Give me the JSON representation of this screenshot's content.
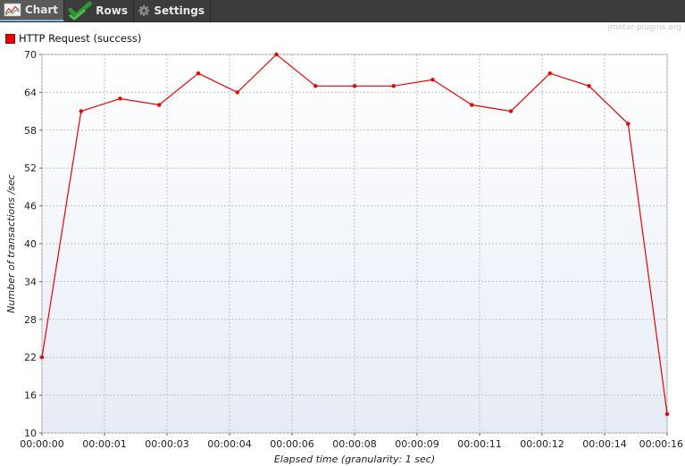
{
  "tabs": [
    {
      "label": "Chart",
      "icon": "chart-icon",
      "active": true
    },
    {
      "label": "Rows",
      "icon": "checkmark-icon",
      "active": false
    },
    {
      "label": "Settings",
      "icon": "gear-icon",
      "active": false
    }
  ],
  "plugin_tag": "jmeter-plugins.org",
  "colors": {
    "series": "#ee0000",
    "grid": "#c0c0c0",
    "toolbar": "#3c3c3c"
  },
  "chart_data": {
    "type": "line",
    "xlabel": "Elapsed time (granularity: 1 sec)",
    "ylabel": "Number of transactions /sec",
    "ylim": [
      10,
      70
    ],
    "yticks": [
      10,
      16,
      22,
      28,
      34,
      40,
      46,
      52,
      58,
      64,
      70
    ],
    "xlim": [
      0,
      16
    ],
    "xticks": [
      {
        "x": 0,
        "label": "00:00:00"
      },
      {
        "x": 1.6,
        "label": "00:00:01"
      },
      {
        "x": 3.2,
        "label": "00:00:03"
      },
      {
        "x": 4.8,
        "label": "00:00:04"
      },
      {
        "x": 6.4,
        "label": "00:00:06"
      },
      {
        "x": 8,
        "label": "00:00:08"
      },
      {
        "x": 9.6,
        "label": "00:00:09"
      },
      {
        "x": 11.2,
        "label": "00:00:11"
      },
      {
        "x": 12.8,
        "label": "00:00:12"
      },
      {
        "x": 14.4,
        "label": "00:00:14"
      },
      {
        "x": 16,
        "label": "00:00:16"
      }
    ],
    "grid": true,
    "legend_position": "top-left",
    "series": [
      {
        "name": "HTTP Request (success)",
        "color": "#ee0000",
        "x": [
          0,
          1,
          2,
          3,
          4,
          5,
          6,
          7,
          8,
          9,
          10,
          11,
          12,
          13,
          14,
          15,
          16
        ],
        "y": [
          22,
          61,
          63,
          62,
          67,
          64,
          70,
          65,
          65,
          65,
          66,
          62,
          61,
          67,
          65,
          59,
          13
        ]
      }
    ]
  }
}
